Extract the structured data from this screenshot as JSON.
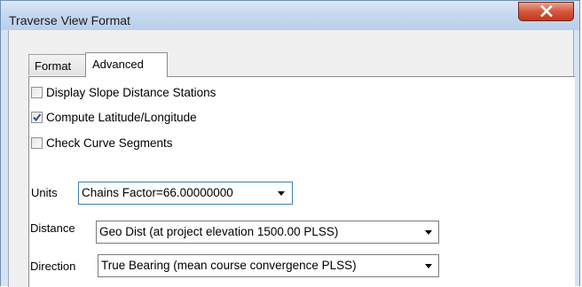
{
  "window": {
    "title": "Traverse View Format",
    "close_icon": "close-icon"
  },
  "tabs": [
    {
      "label": "Format",
      "active": false
    },
    {
      "label": "Advanced",
      "active": true
    }
  ],
  "options": {
    "display_slope_distance_stations": {
      "label": "Display Slope Distance Stations",
      "checked": false
    },
    "compute_lat_long": {
      "label": "Compute Latitude/Longitude",
      "checked": true
    },
    "check_curve_segments": {
      "label": "Check Curve Segments",
      "checked": false
    }
  },
  "fields": {
    "units": {
      "label": "Units",
      "value": "Chains  Factor=66.00000000"
    },
    "distance": {
      "label": "Distance",
      "value": "Geo Dist (at project elevation 1500.00 PLSS)"
    },
    "direction": {
      "label": "Direction",
      "value": "True Bearing (mean course convergence PLSS)"
    }
  }
}
